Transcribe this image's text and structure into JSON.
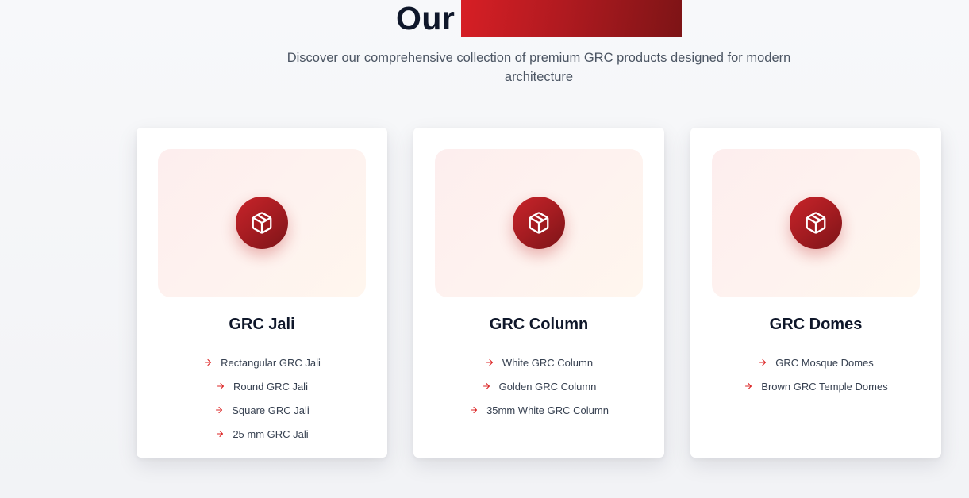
{
  "heading": {
    "word": "Our",
    "highlight_color": "#b11a20"
  },
  "subtitle": "Discover our comprehensive collection of premium GRC products designed for modern architecture",
  "cards": [
    {
      "title": "GRC Jali",
      "icon": "package-icon",
      "items": [
        "Rectangular GRC Jali",
        "Round GRC Jali",
        "Square GRC Jali",
        "25 mm GRC Jali"
      ]
    },
    {
      "title": "GRC Column",
      "icon": "package-icon",
      "items": [
        "White GRC Column",
        "Golden GRC Column",
        "35mm White GRC Column"
      ]
    },
    {
      "title": "GRC Domes",
      "icon": "package-icon",
      "items": [
        "GRC Mosque Domes",
        "Brown GRC Temple Domes"
      ]
    }
  ],
  "colors": {
    "accent": "#b91c1c",
    "text_dark": "#0f172a",
    "text_muted": "#4b5563"
  }
}
